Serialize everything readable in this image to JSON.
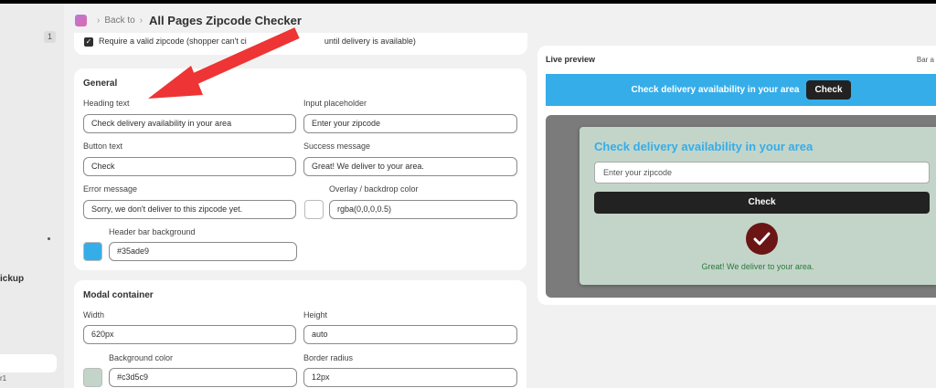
{
  "sidebar": {
    "badge": "1",
    "pickup_label": "ickup",
    "last_label": "r1"
  },
  "breadcrumb": {
    "back_label": "Back to",
    "title": "All Pages Zipcode Checker"
  },
  "require": {
    "checked": true,
    "label": "Require a valid zipcode (shopper can't ci                                  until delivery is available)"
  },
  "general": {
    "title": "General",
    "heading_text": {
      "label": "Heading text",
      "value": "Check delivery availability in your area"
    },
    "input_placeholder": {
      "label": "Input placeholder",
      "value": "Enter your zipcode"
    },
    "button_text": {
      "label": "Button text",
      "value": "Check"
    },
    "success_message": {
      "label": "Success message",
      "value": "Great! We deliver to your area."
    },
    "error_message": {
      "label": "Error message",
      "value": "Sorry, we don't deliver to this zipcode yet."
    },
    "overlay_color": {
      "label": "Overlay / backdrop color",
      "value": "rgba(0,0,0,0.5)",
      "swatch": "#ffffff"
    },
    "header_bar_background": {
      "label": "Header bar background",
      "value": "#35ade9",
      "swatch": "#35ade9"
    }
  },
  "modal_container": {
    "title": "Modal container",
    "width": {
      "label": "Width",
      "value": "620px"
    },
    "height": {
      "label": "Height",
      "value": "auto"
    },
    "background_color": {
      "label": "Background color",
      "value": "#c3d5c9",
      "swatch": "#c3d5c9"
    },
    "border_radius": {
      "label": "Border radius",
      "value": "12px"
    }
  },
  "live_preview": {
    "title": "Live preview",
    "right_label": "Bar a",
    "header_bar_text": "Check delivery availability in your area",
    "header_bar_button": "Check",
    "modal_heading": "Check delivery availability in your area",
    "modal_input_placeholder": "Enter your zipcode",
    "modal_button": "Check",
    "success_message": "Great! We deliver to your area."
  },
  "colors": {
    "accent": "#35ade9",
    "button": "#222222",
    "success_icon": "#6b1515",
    "success_text": "#2a7a3c",
    "annotation_arrow": "#ee3434"
  },
  "icons": {
    "app": "app-icon",
    "chevron": "chevron-right-icon",
    "checkbox": "checkmark-icon",
    "success": "check-circle-icon",
    "annotation": "red-arrow-icon"
  }
}
